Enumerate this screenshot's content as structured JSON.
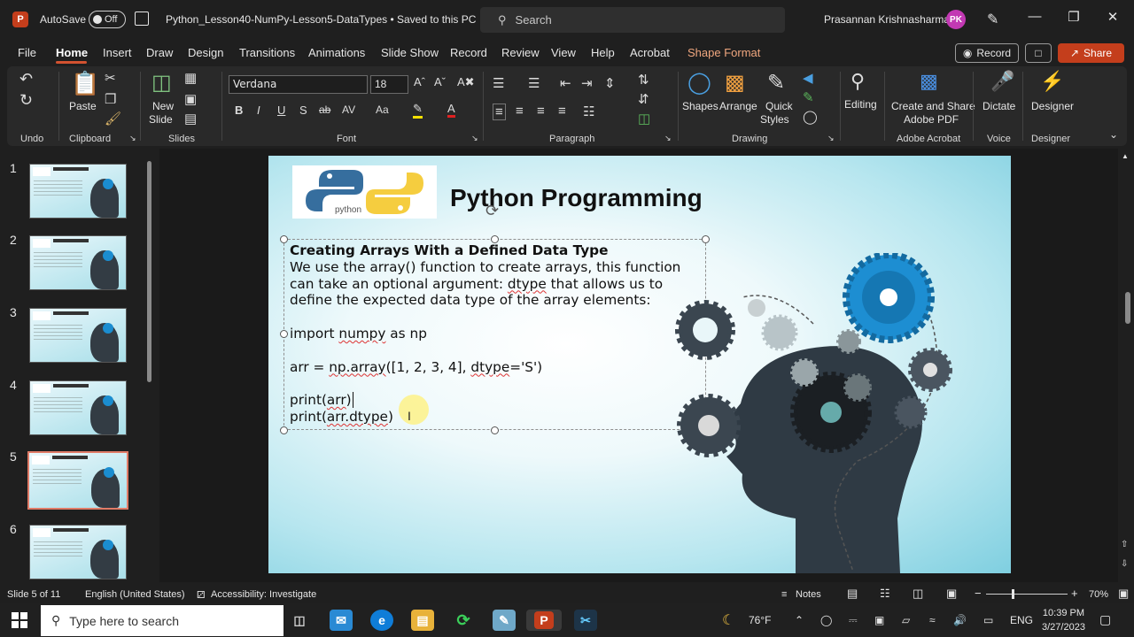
{
  "titlebar": {
    "autosave_label": "AutoSave",
    "autosave_state": "Off",
    "document_title": "Python_Lesson40-NumPy-Lesson5-DataTypes • Saved to this PC",
    "search_placeholder": "Search",
    "user_name": "Prasannan Krishnasharma",
    "user_initials": "PK"
  },
  "menu": {
    "items": [
      "File",
      "Home",
      "Insert",
      "Draw",
      "Design",
      "Transitions",
      "Animations",
      "Slide Show",
      "Record",
      "Review",
      "View",
      "Help",
      "Acrobat",
      "Shape Format"
    ],
    "active": "Home",
    "record_button": "Record",
    "share_button": "Share"
  },
  "ribbon": {
    "groups": [
      "Undo",
      "Clipboard",
      "Slides",
      "Font",
      "Paragraph",
      "Drawing",
      "Adobe Acrobat",
      "Voice",
      "Designer"
    ],
    "paste_label": "Paste",
    "new_slide_label_1": "New",
    "new_slide_label_2": "Slide",
    "font_name": "Verdana",
    "font_size": "18",
    "shapes_label": "Shapes",
    "arrange_label": "Arrange",
    "quick_styles_1": "Quick",
    "quick_styles_2": "Styles",
    "editing_label": "Editing",
    "acrobat_label_1": "Create and Share",
    "acrobat_label_2": "Adobe PDF",
    "dictate_label": "Dictate",
    "designer_label": "Designer"
  },
  "thumbnails": {
    "numbers": [
      "1",
      "2",
      "3",
      "4",
      "5",
      "6"
    ],
    "selected": "5"
  },
  "slide": {
    "logo_text": "python",
    "title": "Python Programming",
    "heading": "Creating Arrays With a Defined Data Type",
    "body_line1": "We use the array() function to create arrays, this function",
    "body_line2_a": "can take an optional argument: ",
    "body_line2_b": "dtype",
    "body_line2_c": " that allows us to",
    "body_line3": "define the expected data type of the array elements:",
    "code1_a": "import ",
    "code1_b": "numpy",
    "code1_c": " as np",
    "code2_a": "arr = ",
    "code2_b": "np.array",
    "code2_c": "([1, 2, 3, 4], ",
    "code2_d": "dtype",
    "code2_e": "='S')",
    "code3_a": "print(",
    "code3_b": "arr",
    "code3_c": ")",
    "code4_a": "print(",
    "code4_b": "arr.dtype",
    "code4_c": ")"
  },
  "statusbar": {
    "slide_info": "Slide 5 of 11",
    "language": "English (United States)",
    "accessibility": "Accessibility: Investigate",
    "notes": "Notes",
    "zoom": "70%"
  },
  "taskbar": {
    "search_placeholder": "Type here to search",
    "weather": "76°F",
    "language": "ENG",
    "time": "10:39 PM",
    "date": "3/27/2023"
  },
  "colors": {
    "accent": "#c43e1c",
    "shape_format": "#f0a77f",
    "selected_thumb_border": "#e07b67"
  }
}
